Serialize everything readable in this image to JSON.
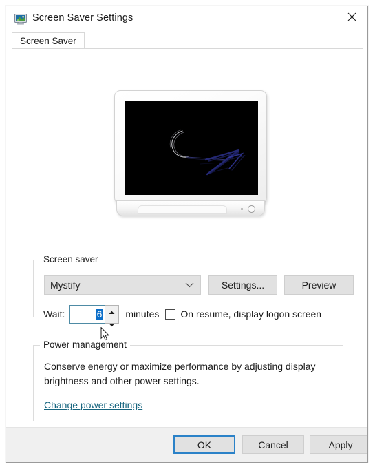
{
  "window": {
    "title": "Screen Saver Settings",
    "icon": "display-monitor-icon",
    "close_icon": "close-icon"
  },
  "tabs": [
    {
      "label": "Screen Saver",
      "active": true
    }
  ],
  "preview": {
    "name": "screen-saver-preview-monitor",
    "screen_background": "#000000",
    "pattern": "mystify"
  },
  "screen_saver_group": {
    "title": "Screen saver",
    "combo": {
      "selected": "Mystify",
      "chevron_icon": "chevron-down-icon"
    },
    "settings_button": "Settings...",
    "preview_button": "Preview",
    "wait_label": "Wait:",
    "wait_value": "6",
    "minutes_label": "minutes",
    "resume_checkbox_label": "On resume, display logon screen",
    "resume_checkbox_checked": false,
    "up_arrow_icon": "chevron-up-icon",
    "down_arrow_icon": "chevron-down-icon"
  },
  "power_group": {
    "title": "Power management",
    "description": "Conserve energy or maximize performance by adjusting display brightness and other power settings.",
    "link": "Change power settings",
    "link_color": "#17657f"
  },
  "footer": {
    "ok": "OK",
    "cancel": "Cancel",
    "apply": "Apply",
    "focus_color": "#2b82c8"
  },
  "cursor": {
    "icon": "mouse-pointer-icon"
  }
}
